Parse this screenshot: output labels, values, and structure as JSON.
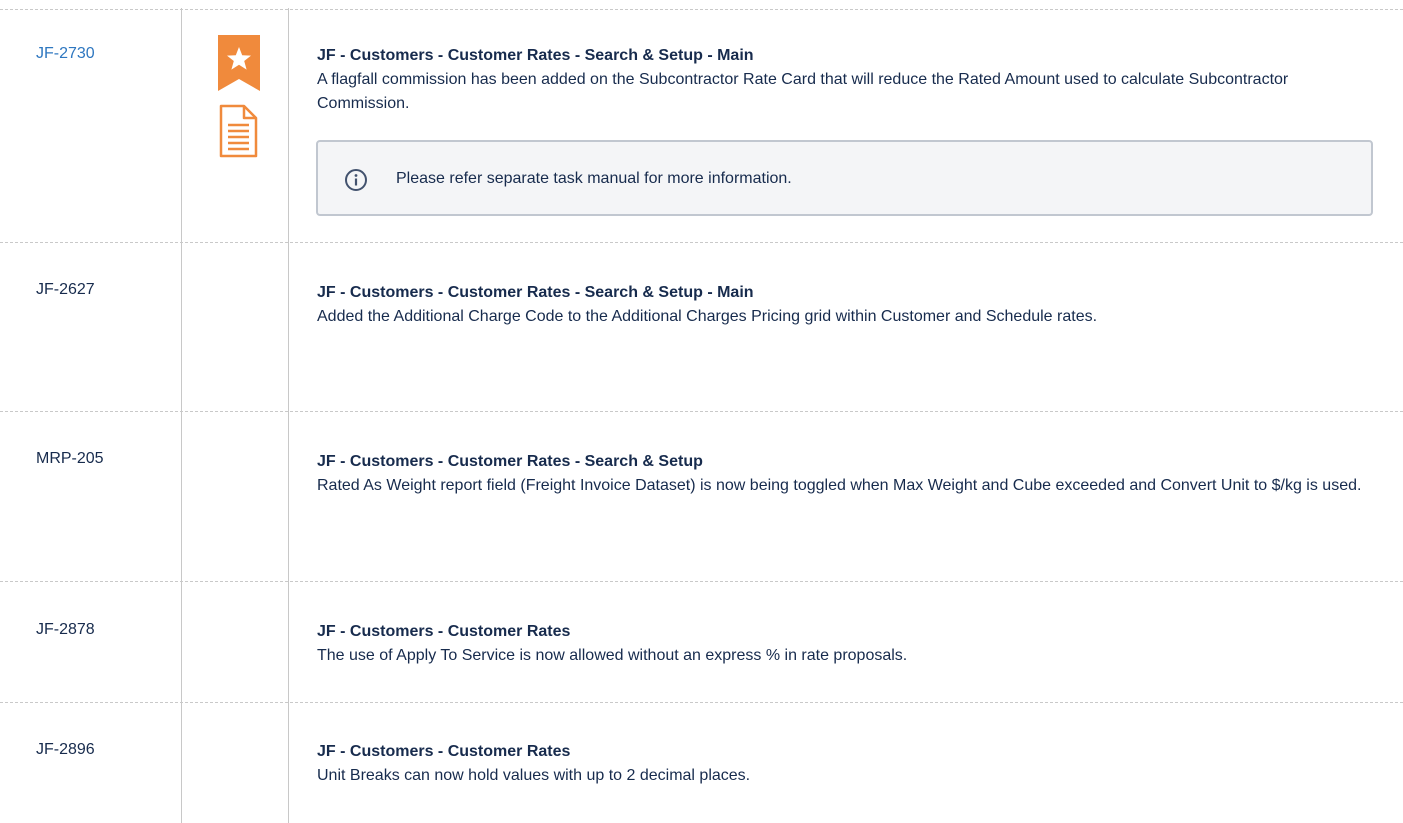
{
  "rows": [
    {
      "id": "JF-2730",
      "title": "JF - Customers - Customer Rates - Search & Setup - Main",
      "description": "A flagfall commission has been added on the Subcontractor Rate Card that will reduce the Rated Amount used to calculate Subcontractor Commission.",
      "note": "Please refer separate task manual for more information."
    },
    {
      "id": "JF-2627",
      "title": "JF - Customers - Customer Rates - Search & Setup - Main",
      "description": "Added the Additional Charge Code to the Additional Charges Pricing grid within Customer and Schedule rates."
    },
    {
      "id": "MRP-205",
      "title": "JF - Customers - Customer Rates - Search & Setup",
      "description": "Rated As Weight report field (Freight Invoice Dataset) is now being toggled when Max Weight and Cube exceeded and Convert Unit to $/kg is used."
    },
    {
      "id": "JF-2878",
      "title": "JF - Customers - Customer Rates",
      "description": "The use of Apply To Service is now allowed without an express % in rate proposals."
    },
    {
      "id": "JF-2896",
      "title": "JF - Customers - Customer Rates",
      "description": "Unit Breaks can now hold values with up to 2 decimal places."
    }
  ],
  "icons": {
    "badge": "star-bookmark-icon",
    "document": "document-icon",
    "info": "info-icon"
  },
  "colors": {
    "accent_orange": "#f08a3c",
    "link_blue": "#2e77c0",
    "panel_border": "#c1c7d0",
    "panel_bg": "#f4f5f7"
  }
}
